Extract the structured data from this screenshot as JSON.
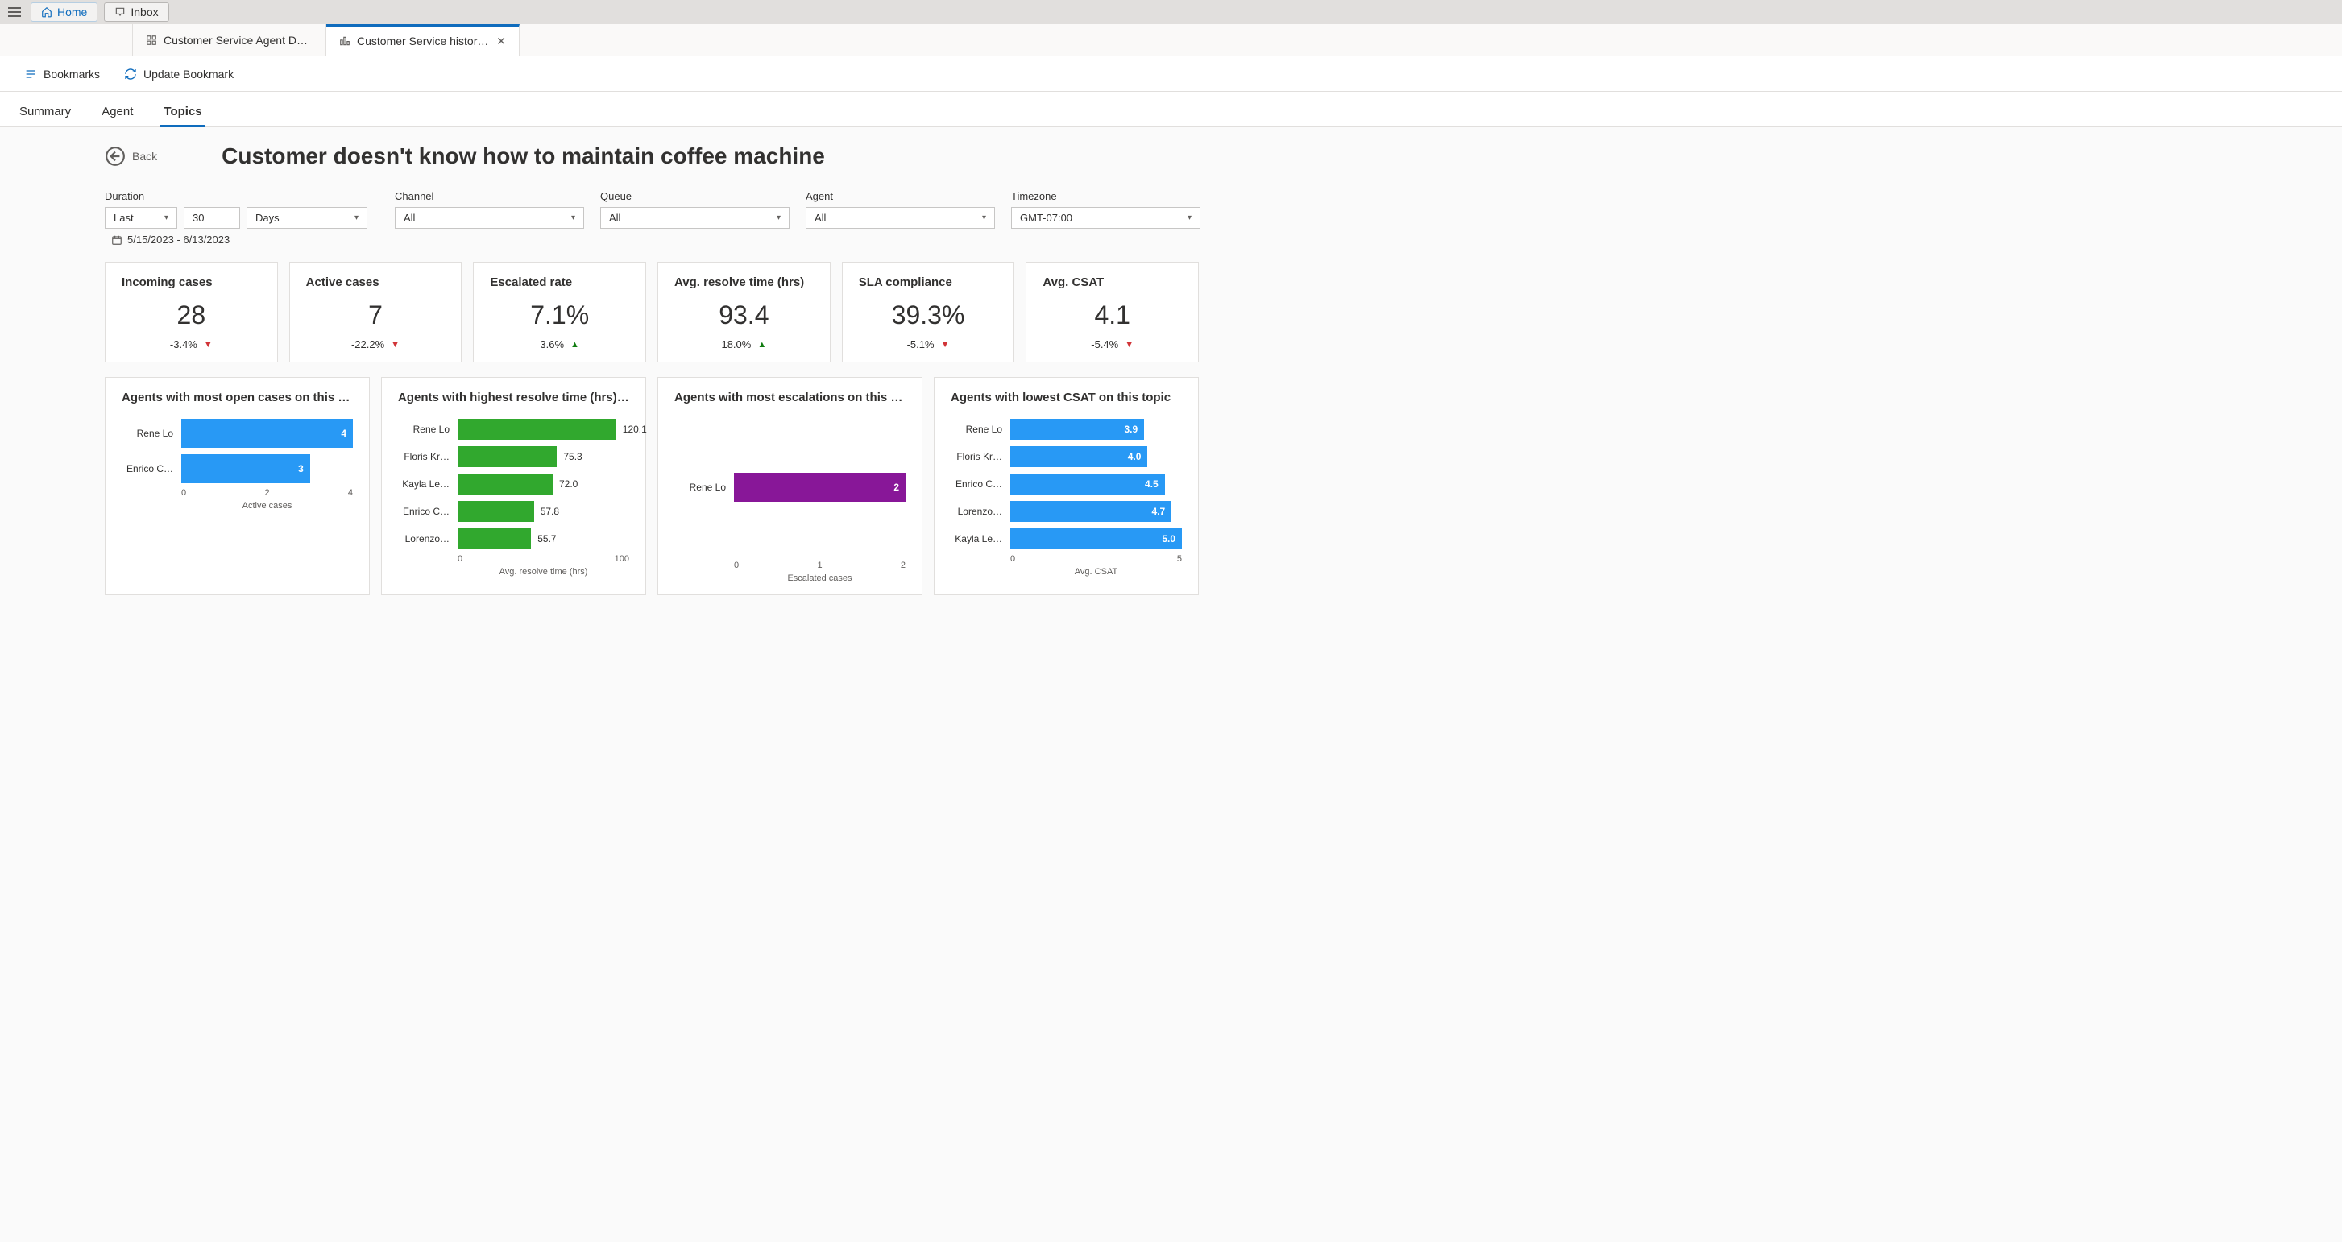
{
  "header": {
    "home": "Home",
    "inbox": "Inbox"
  },
  "tabs": [
    {
      "label": "Customer Service Agent Dash…",
      "active": false
    },
    {
      "label": "Customer Service historica…",
      "active": true
    }
  ],
  "bookmarks": {
    "bookmarks_label": "Bookmarks",
    "update_label": "Update Bookmark"
  },
  "section_nav": {
    "summary": "Summary",
    "agent": "Agent",
    "topics": "Topics"
  },
  "back_label": "Back",
  "page_title": "Customer doesn't know how to maintain coffee machine",
  "filters": {
    "duration_label": "Duration",
    "duration_type": "Last",
    "duration_qty": "30",
    "duration_unit": "Days",
    "channel_label": "Channel",
    "channel_value": "All",
    "queue_label": "Queue",
    "queue_value": "All",
    "agent_label": "Agent",
    "agent_value": "All",
    "tz_label": "Timezone",
    "tz_value": "GMT-07:00",
    "date_range": "5/15/2023 - 6/13/2023"
  },
  "kpi": [
    {
      "title": "Incoming cases",
      "value": "28",
      "delta": "-3.4%",
      "dir": "down"
    },
    {
      "title": "Active cases",
      "value": "7",
      "delta": "-22.2%",
      "dir": "down"
    },
    {
      "title": "Escalated rate",
      "value": "7.1%",
      "delta": "3.6%",
      "dir": "up"
    },
    {
      "title": "Avg. resolve time (hrs)",
      "value": "93.4",
      "delta": "18.0%",
      "dir": "up"
    },
    {
      "title": "SLA compliance",
      "value": "39.3%",
      "delta": "-5.1%",
      "dir": "down"
    },
    {
      "title": "Avg. CSAT",
      "value": "4.1",
      "delta": "-5.4%",
      "dir": "down"
    }
  ],
  "chart_data": [
    {
      "type": "bar",
      "title": "Agents with most open cases on this to…",
      "xlabel": "Active cases",
      "xlim": [
        0,
        4
      ],
      "ticks": [
        "0",
        "2",
        "4"
      ],
      "color": "blue",
      "thick": true,
      "series": [
        {
          "label": "Rene Lo",
          "value": 4,
          "display": "4",
          "inside": true
        },
        {
          "label": "Enrico C…",
          "value": 3,
          "display": "3",
          "inside": true
        }
      ]
    },
    {
      "type": "bar",
      "title": "Agents with highest resolve time (hrs) o…",
      "xlabel": "Avg. resolve time (hrs)",
      "xlim": [
        0,
        130
      ],
      "ticks": [
        "0",
        "100"
      ],
      "color": "green",
      "series": [
        {
          "label": "Rene Lo",
          "value": 120.1,
          "display": "120.1"
        },
        {
          "label": "Floris Kr…",
          "value": 75.3,
          "display": "75.3"
        },
        {
          "label": "Kayla Le…",
          "value": 72.0,
          "display": "72.0"
        },
        {
          "label": "Enrico C…",
          "value": 57.8,
          "display": "57.8"
        },
        {
          "label": "Lorenzo…",
          "value": 55.7,
          "display": "55.7"
        }
      ]
    },
    {
      "type": "bar",
      "title": "Agents with most escalations on this to…",
      "xlabel": "Escalated cases",
      "xlim": [
        0,
        2
      ],
      "ticks": [
        "0",
        "1",
        "2"
      ],
      "color": "purple",
      "thick": true,
      "centered": true,
      "series": [
        {
          "label": "Rene Lo",
          "value": 2,
          "display": "2",
          "inside": true
        }
      ]
    },
    {
      "type": "bar",
      "title": "Agents with lowest CSAT on this topic",
      "xlabel": "Avg. CSAT",
      "xlim": [
        0,
        5
      ],
      "ticks": [
        "0",
        "5"
      ],
      "color": "blue",
      "series": [
        {
          "label": "Rene Lo",
          "value": 3.9,
          "display": "3.9",
          "inside": true
        },
        {
          "label": "Floris Kr…",
          "value": 4.0,
          "display": "4.0",
          "inside": true
        },
        {
          "label": "Enrico C…",
          "value": 4.5,
          "display": "4.5",
          "inside": true
        },
        {
          "label": "Lorenzo…",
          "value": 4.7,
          "display": "4.7",
          "inside": true
        },
        {
          "label": "Kayla Le…",
          "value": 5.0,
          "display": "5.0",
          "inside": true
        }
      ]
    }
  ]
}
